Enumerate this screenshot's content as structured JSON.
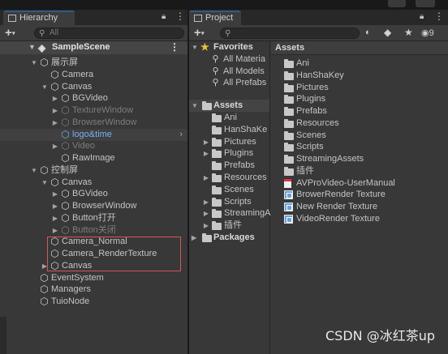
{
  "hierarchy": {
    "tab_label": "Hierarchy",
    "lock_icon": "lock-icon",
    "menu_icon": "kebab-menu-icon",
    "search_placeholder": "All",
    "scene_name": "SampleScene",
    "items": [
      {
        "label": "展示屏",
        "depth": 1,
        "fold": "open",
        "state": "normal"
      },
      {
        "label": "Camera",
        "depth": 2,
        "fold": "none",
        "state": "normal"
      },
      {
        "label": "Canvas",
        "depth": 2,
        "fold": "open",
        "state": "normal"
      },
      {
        "label": "BGVideo",
        "depth": 3,
        "fold": "closed",
        "state": "normal"
      },
      {
        "label": "TextureWindow",
        "depth": 3,
        "fold": "closed",
        "state": "disabled"
      },
      {
        "label": "BrowserWindow",
        "depth": 3,
        "fold": "closed",
        "state": "disabled"
      },
      {
        "label": "logo&time",
        "depth": 3,
        "fold": "none",
        "state": "prefab",
        "chevron": true
      },
      {
        "label": "Video",
        "depth": 3,
        "fold": "closed",
        "state": "disabled"
      },
      {
        "label": "RawImage",
        "depth": 3,
        "fold": "none",
        "state": "normal"
      },
      {
        "label": "控制屏",
        "depth": 1,
        "fold": "open",
        "state": "normal"
      },
      {
        "label": "Canvas",
        "depth": 2,
        "fold": "open",
        "state": "normal"
      },
      {
        "label": "BGVideo",
        "depth": 3,
        "fold": "closed",
        "state": "normal"
      },
      {
        "label": "BrowserWindow",
        "depth": 3,
        "fold": "closed",
        "state": "normal"
      },
      {
        "label": "Button打开",
        "depth": 3,
        "fold": "closed",
        "state": "normal"
      },
      {
        "label": "Button关闭",
        "depth": 3,
        "fold": "closed",
        "state": "disabled"
      },
      {
        "label": "Camera_Normal",
        "depth": 2,
        "fold": "none",
        "state": "normal"
      },
      {
        "label": "Camera_RenderTexture",
        "depth": 2,
        "fold": "none",
        "state": "normal"
      },
      {
        "label": "Canvas",
        "depth": 2,
        "fold": "closed",
        "state": "normal"
      },
      {
        "label": "EventSystem",
        "depth": 1,
        "fold": "none",
        "state": "normal"
      },
      {
        "label": "Managers",
        "depth": 1,
        "fold": "none",
        "state": "normal"
      },
      {
        "label": "TuioNode",
        "depth": 1,
        "fold": "none",
        "state": "normal"
      }
    ]
  },
  "project": {
    "tab_label": "Project",
    "lock_icon": "lock-icon",
    "menu_icon": "kebab-menu-icon",
    "hidden_packages_count": "9",
    "favorites": {
      "label": "Favorites",
      "items": [
        "All Materia",
        "All Models",
        "All Prefabs"
      ]
    },
    "assets_tree": {
      "label": "Assets",
      "items": [
        {
          "label": "Ani",
          "fold": false
        },
        {
          "label": "HanShaKe",
          "fold": false
        },
        {
          "label": "Pictures",
          "fold": true
        },
        {
          "label": "Plugins",
          "fold": true
        },
        {
          "label": "Prefabs",
          "fold": false
        },
        {
          "label": "Resources",
          "fold": true
        },
        {
          "label": "Scenes",
          "fold": false
        },
        {
          "label": "Scripts",
          "fold": true
        },
        {
          "label": "StreamingA",
          "fold": true
        },
        {
          "label": "插件",
          "fold": true
        }
      ]
    },
    "packages_label": "Packages",
    "breadcrumb": "Assets",
    "asset_list": [
      {
        "label": "Ani",
        "kind": "folder"
      },
      {
        "label": "HanShaKey",
        "kind": "folder"
      },
      {
        "label": "Pictures",
        "kind": "folder"
      },
      {
        "label": "Plugins",
        "kind": "folder"
      },
      {
        "label": "Prefabs",
        "kind": "folder"
      },
      {
        "label": "Resources",
        "kind": "folder"
      },
      {
        "label": "Scenes",
        "kind": "folder"
      },
      {
        "label": "Scripts",
        "kind": "folder"
      },
      {
        "label": "StreamingAssets",
        "kind": "folder"
      },
      {
        "label": "插件",
        "kind": "folder"
      },
      {
        "label": "AVProVideo-UserManual",
        "kind": "pdf"
      },
      {
        "label": "BrowerRender Texture",
        "kind": "render-texture"
      },
      {
        "label": "New Render Texture",
        "kind": "render-texture"
      },
      {
        "label": "VideoRender Texture",
        "kind": "render-texture"
      }
    ]
  },
  "watermark": "CSDN @冰红茶up",
  "colors": {
    "panel_bg": "#383838",
    "prefab_blue": "#79aff0",
    "highlight_box": "#d9535a",
    "disabled_text": "#7d7d7d"
  }
}
